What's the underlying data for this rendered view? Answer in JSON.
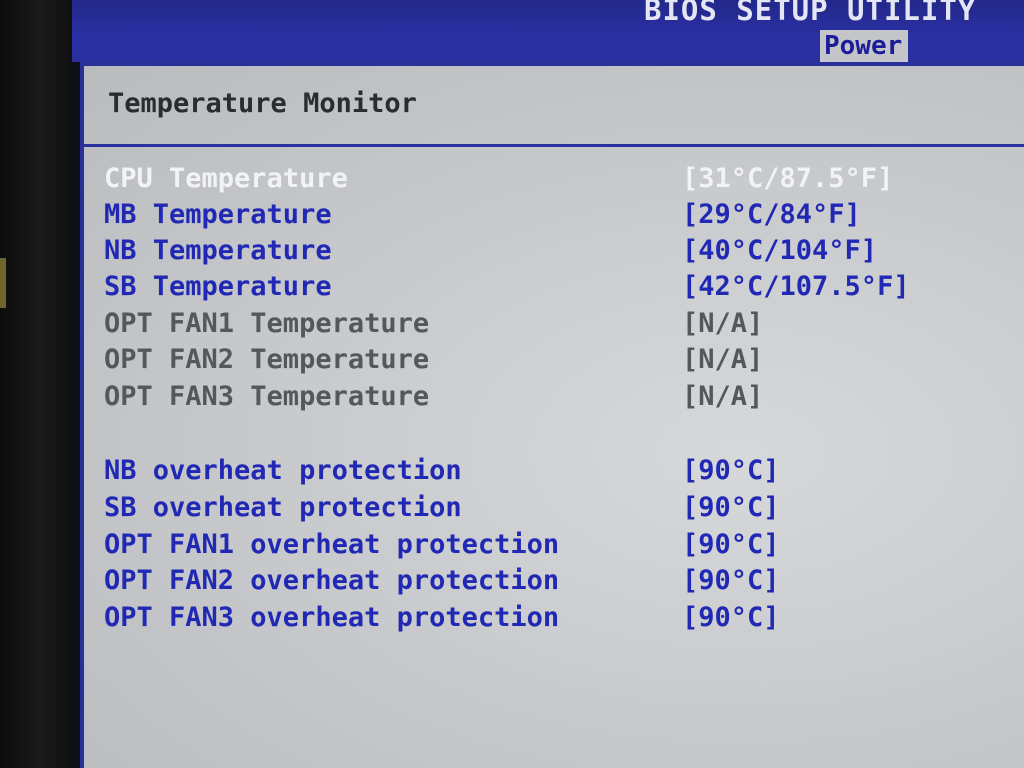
{
  "header": {
    "utility_title": "BIOS SETUP UTILITY",
    "active_tab": "Power"
  },
  "page": {
    "title": "Temperature Monitor"
  },
  "monitor": [
    {
      "label": "CPU Temperature",
      "value": "[31°C/87.5°F]",
      "state": "highlighted"
    },
    {
      "label": "MB Temperature",
      "value": "[29°C/84°F]",
      "state": "normal"
    },
    {
      "label": "NB Temperature",
      "value": "[40°C/104°F]",
      "state": "normal"
    },
    {
      "label": "SB Temperature",
      "value": "[42°C/107.5°F]",
      "state": "normal"
    },
    {
      "label": "OPT FAN1 Temperature",
      "value": "[N/A]",
      "state": "disabled"
    },
    {
      "label": "OPT FAN2 Temperature",
      "value": "[N/A]",
      "state": "disabled"
    },
    {
      "label": "OPT FAN3 Temperature",
      "value": "[N/A]",
      "state": "disabled"
    }
  ],
  "protection": [
    {
      "label": "NB overheat protection",
      "value": "[90°C]"
    },
    {
      "label": "SB overheat protection",
      "value": "[90°C]"
    },
    {
      "label": "OPT FAN1 overheat protection",
      "value": "[90°C]"
    },
    {
      "label": "OPT FAN2 overheat protection",
      "value": "[90°C]"
    },
    {
      "label": "OPT FAN3 overheat protection",
      "value": "[90°C]"
    }
  ],
  "colors": {
    "header_blue": "#2a30a4",
    "panel_gray": "#c6c8cb",
    "item_blue": "#2129b4",
    "highlight_white": "#f2f3f5",
    "disabled_gray": "#55575c"
  }
}
